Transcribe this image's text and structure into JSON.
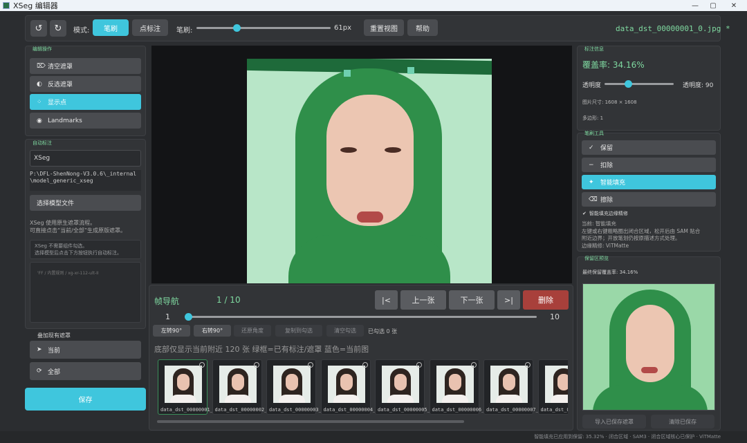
{
  "window": {
    "title": "XSeg 编辑器"
  },
  "toolbar": {
    "mode_label": "模式:",
    "mode_brush": "笔刷",
    "mode_point": "点标注",
    "brush_label": "笔刷:",
    "brush_size": "61px",
    "brush_value": 0.3,
    "reset_view": "重置视图",
    "help": "帮助",
    "filename": "data_dst_00000001_0.jpg *"
  },
  "left": {
    "edit_title": "编辑操作",
    "clear_mask": "清空遮罩",
    "invert_mask": "反选遮罩",
    "show_points": "显示点",
    "landmarks": "Landmarks",
    "auto_title": "自动标注",
    "model_name": "XSeg",
    "model_path": "P:\\DFL-ShenNong-V3.0.6\\_internal\\model_generic_xseg",
    "select_model": "选择模型文件",
    "info_line1": "XSeg 使用原生遮罩流程。",
    "info_line2": "可直接点击“当前/全部”生成原版遮罩。",
    "hint_line1": "XSeg 不需要组件勾选。",
    "hint_line2": "选择模型后点击下方按钮执行自动标注。",
    "placeholder": "'FF / 内置规则 / xg-xr-112-ult-II",
    "overlay_title": "叠加现有遮罩",
    "current": "当前",
    "all": "全部",
    "save": "保存"
  },
  "nav": {
    "title": "帧导航",
    "counter": "1 / 10",
    "first": "|<",
    "prev": "上一张",
    "next": "下一张",
    "last": ">|",
    "delete": "删除",
    "slider_min": "1",
    "slider_max": "10",
    "rotate_left": "左转90°",
    "rotate_right": "右转90°",
    "restore_angle": "还原角度",
    "copy_to_checked": "复制到勾选",
    "clear_checked": "清空勾选",
    "checked_count": "已勾选 0 张",
    "legend": "底部仅显示当前附近 120 张  绿框=已有标注/遮罩  蓝色=当前图"
  },
  "thumbs": [
    "data_dst_00000001_0",
    "data_dst_00000002_0",
    "data_dst_00000003_0",
    "data_dst_00000004_0",
    "data_dst_00000005_0",
    "data_dst_00000006_0",
    "data_dst_00000007_0",
    "data_dst_0"
  ],
  "right": {
    "info_title": "标注信息",
    "coverage": "覆盖率: 34.16%",
    "opacity_label": "透明度",
    "opacity_value": "透明度: 90",
    "opacity_level": 0.34,
    "image_size": "图片尺寸: 1608 × 1608",
    "polygons": "多边形: 1",
    "tools_title": "笔刷工具",
    "keep": "保留",
    "remove": "扣除",
    "smart_fill": "智能填充",
    "erase": "擦除",
    "checkbox": "智能填充边缘精修",
    "desc1": "当前: 智能填充",
    "desc2": "左键或右键粗略圈出闭合区域，松开后由 SAM 贴合",
    "desc3": "附近边界；开放笔划仍按原描述方式处理。",
    "desc4": "边缘精修: ViTMatte",
    "preview_title": "保留区预览",
    "final_coverage": "最终保留覆盖率: 34.16%",
    "import_saved": "导入已保存遮罩",
    "clear_saved": "清除已保存"
  },
  "status": "智能填充已应用到保留: 35.32% · 闭合区域 · SAM3 · 闭合区域核心已保护 · ViTMatte",
  "colors": {
    "accent": "#3fc6dd",
    "delete": "#a8403b",
    "hair_mask": "#2f8f4a",
    "green_text": "#7fd9a0"
  }
}
